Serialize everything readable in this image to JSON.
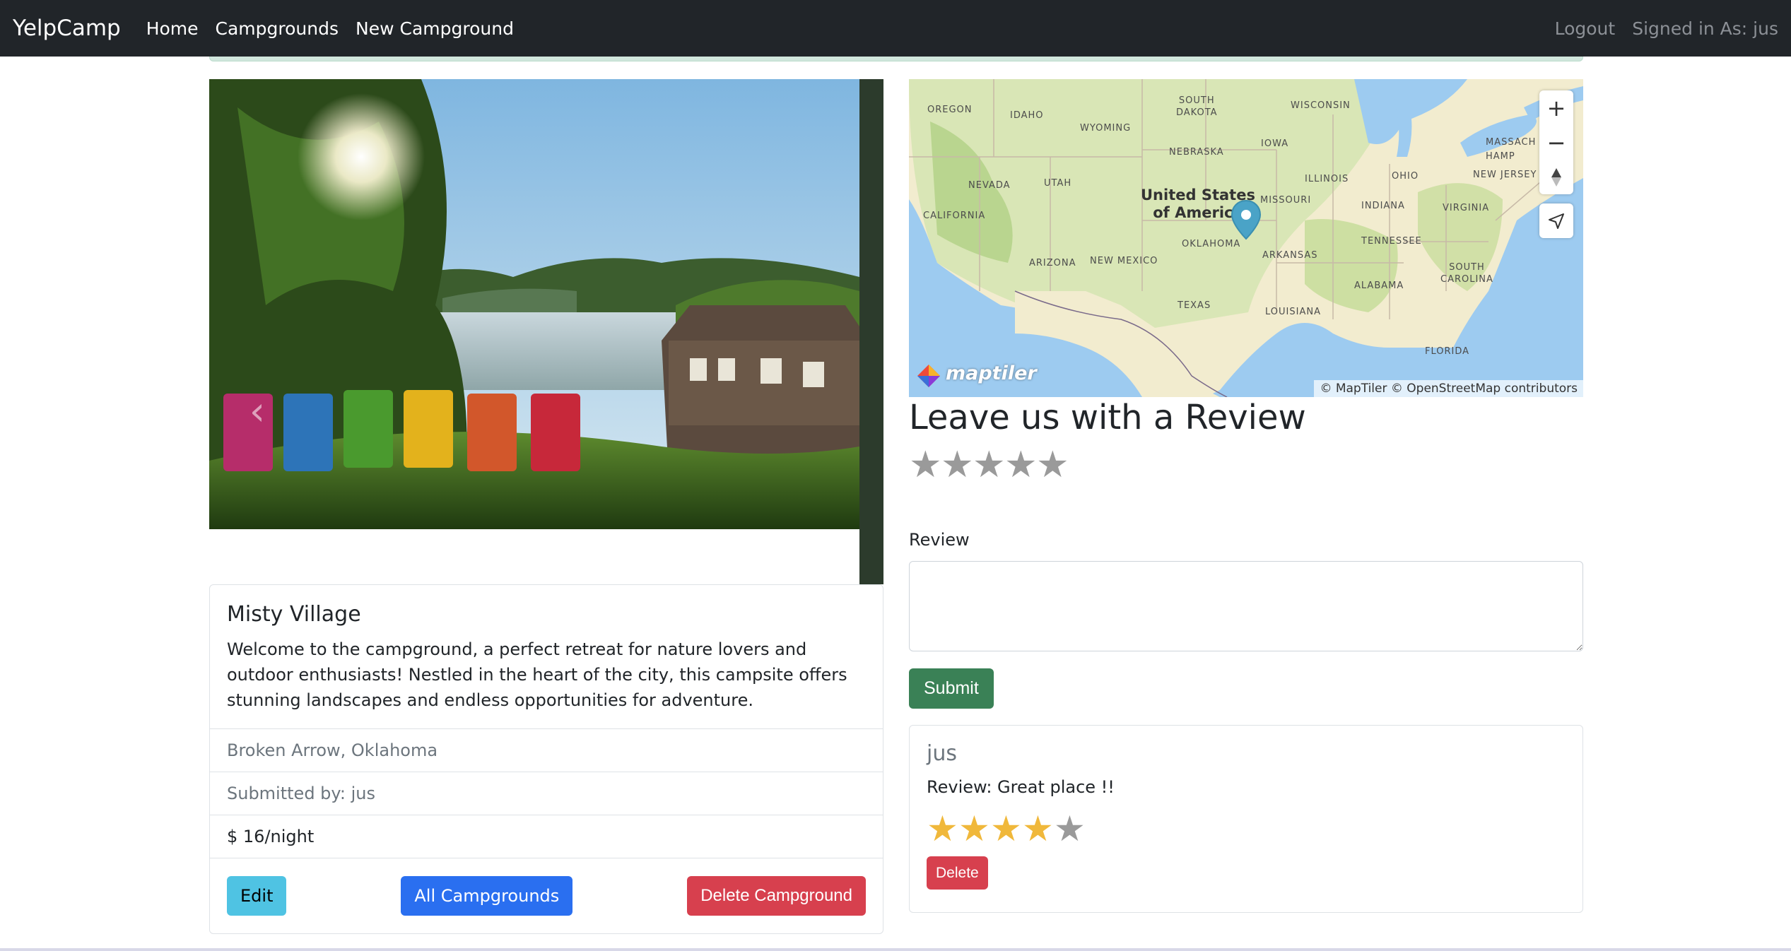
{
  "navbar": {
    "brand": "YelpCamp",
    "links": [
      "Home",
      "Campgrounds",
      "New Campground"
    ],
    "logout": "Logout",
    "signed_in": "Signed in As: jus"
  },
  "carousel": {
    "prev_icon": "‹",
    "next_icon": "›"
  },
  "campground": {
    "title": "Misty Village",
    "description": "Welcome to the campground, a perfect retreat for nature lovers and outdoor enthusiasts! Nestled in the heart of the city, this campsite offers stunning landscapes and endless opportunities for adventure.",
    "location": "Broken Arrow, Oklahoma",
    "submitted_by": "Submitted by: jus",
    "price": "$ 16/night",
    "buttons": {
      "edit": "Edit",
      "all": "All Campgrounds",
      "delete": "Delete Campground"
    }
  },
  "map": {
    "zoom_in": "+",
    "zoom_out": "−",
    "logo": "maptiler",
    "attribution": "© MapTiler © OpenStreetMap contributors",
    "country": "United States\nof America",
    "states": {
      "oregon": "OREGON",
      "idaho": "IDAHO",
      "wyoming": "WYOMING",
      "south_dakota": "SOUTH\nDAKOTA",
      "nebraska": "NEBRASKA",
      "iowa": "IOWA",
      "wisconsin": "WISCONSIN",
      "nevada": "NEVADA",
      "utah": "UTAH",
      "california": "CALIFORNIA",
      "missouri": "MISSOURI",
      "illinois": "ILLINOIS",
      "indiana": "INDIANA",
      "ohio": "OHIO",
      "new_jersey": "NEW JERSEY",
      "virginia": "VIRGINIA",
      "tennessee": "TENNESSEE",
      "arizona": "ARIZONA",
      "new_mexico": "NEW MEXICO",
      "oklahoma": "OKLAHOMA",
      "arkansas": "ARKANSAS",
      "south_carolina": "SOUTH\nCAROLINA",
      "alabama": "ALABAMA",
      "texas": "TEXAS",
      "louisiana": "LOUISIANA",
      "florida": "FLORIDA",
      "massachusetts": "MASSACH",
      "hamp": "HAMP"
    }
  },
  "review_form": {
    "title": "Leave us with a Review",
    "review_label": "Review",
    "textarea_value": "",
    "submit": "Submit",
    "stars": [
      "★",
      "★",
      "★",
      "★",
      "★"
    ]
  },
  "reviews": [
    {
      "user": "jus",
      "text": "Review: Great place !!",
      "rating": 4,
      "delete": "Delete"
    }
  ]
}
